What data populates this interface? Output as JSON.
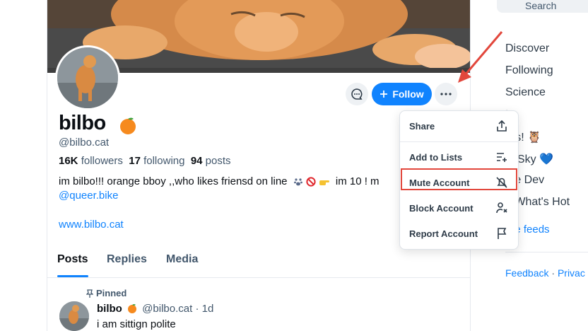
{
  "profile": {
    "display_name": "bilbo",
    "handle": "@bilbo.cat",
    "followers_count": "16K",
    "followers_label": "followers",
    "following_count": "17",
    "following_label": "following",
    "posts_count": "94",
    "posts_label": "posts",
    "bio_before_icons": "im bilbo!!! orange bboy ,,who likes  friensd on line",
    "bio_after_icons": "im 10 ! m",
    "bio_mention": "@queer.bike",
    "website": "www.bilbo.cat"
  },
  "actions": {
    "follow_label": "Follow"
  },
  "tabs": [
    {
      "label": "Posts",
      "active": true
    },
    {
      "label": "Replies",
      "active": false
    },
    {
      "label": "Media",
      "active": false
    }
  ],
  "post": {
    "pinned_label": "Pinned",
    "author_name": "bilbo",
    "author_handle": "@bilbo.cat",
    "time": "1d",
    "text": "i am sittign polite"
  },
  "sidebar": {
    "search_placeholder": "Search",
    "feeds": [
      {
        "label": "Discover"
      },
      {
        "label": "Following"
      },
      {
        "label": "Science"
      },
      {
        "label": "t"
      },
      {
        "label": "rds! 🦉"
      },
      {
        "label": "okSky 💙"
      },
      {
        "label": "me Dev"
      },
      {
        "label": "t: What's Hot"
      }
    ],
    "more_feeds": "ore feeds",
    "footer_feedback": "Feedback",
    "footer_privacy": "Privac"
  },
  "menu": {
    "items": [
      {
        "label": "Share",
        "icon": "share-icon"
      },
      {
        "label": "Add to Lists",
        "icon": "list-add-icon"
      },
      {
        "label": "Mute Account",
        "icon": "mute-icon"
      },
      {
        "label": "Block Account",
        "icon": "block-person-icon"
      },
      {
        "label": "Report Account",
        "icon": "flag-icon"
      }
    ],
    "highlighted": "Mute Account"
  },
  "colors": {
    "accent": "#1083fe",
    "annotation": "#e2473c",
    "text_primary": "#0b0f14",
    "text_secondary": "#42576c"
  }
}
